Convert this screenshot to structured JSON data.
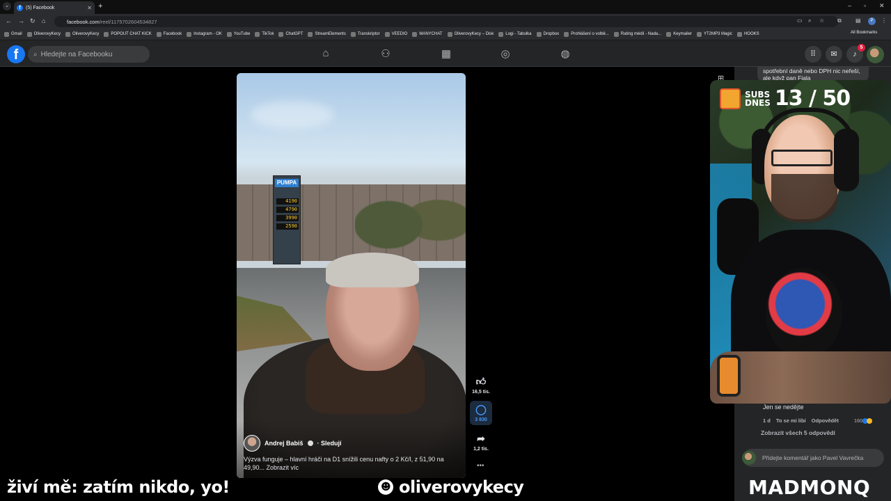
{
  "browser": {
    "tab_title": "(5) Facebook",
    "url_host": "facebook.com",
    "url_path": "/reel/1175702604534827",
    "bookmarks": [
      "Gmail",
      "OliverovyKecy",
      "OliverovyKecy",
      "POPOUT CHAT KICK",
      "Facebook",
      "Instagram - OK",
      "YouTube",
      "TikTok",
      "ChatGPT",
      "StreamElements",
      "Transkriptor",
      "VEEDIO",
      "MANYCHAT",
      "OliverovyKecy – Disk",
      "Logi - Tabulka",
      "Dropbox",
      "Prohlášení o volbě...",
      "Rating médií - Nada...",
      "Keymailer",
      "YT2MP3 Magic",
      "HOOKS"
    ],
    "all_bookmarks": "All Bookmarks",
    "profile_initial": "P"
  },
  "facebook": {
    "search_placeholder": "Hledejte na Facebooku",
    "notifications_count": "5"
  },
  "reel": {
    "author": "Andrej Babiš",
    "follow": "· Sledují",
    "description": "Výzva funguje – hlavní hráči na D1 snížili cenu nafty o 2 Kč/l, z 51,90 na 49,90... Zobrazit víc",
    "pumpa": "PUMPA",
    "prices": [
      "4190",
      "4790",
      "3990",
      "2590"
    ],
    "likes": "16,5 tis.",
    "comments": "3 830",
    "shares": "1,2 tis."
  },
  "comments_panel": {
    "top_comment": "spotřební daně nebo DPH nic neřeší, ale když pan Fiala",
    "reply_text": "Jen se nedějte",
    "reply_age": "1 d",
    "reply_like": "To se mi líbí",
    "reply_answer": "Odpovědět",
    "reply_reactions": "160",
    "show_all": "Zobrazit všech 5 odpovědí",
    "input_placeholder": "Přidejte komentář jako Pavel Vavrečka"
  },
  "stream": {
    "subs_label_1": "SUBS",
    "subs_label_2": "DNES",
    "subs_count": "13 / 50",
    "ticker": "živí mě: zatím nikdo, yo!",
    "handle": "oliverovykecy",
    "brand": "MADMONQ"
  }
}
